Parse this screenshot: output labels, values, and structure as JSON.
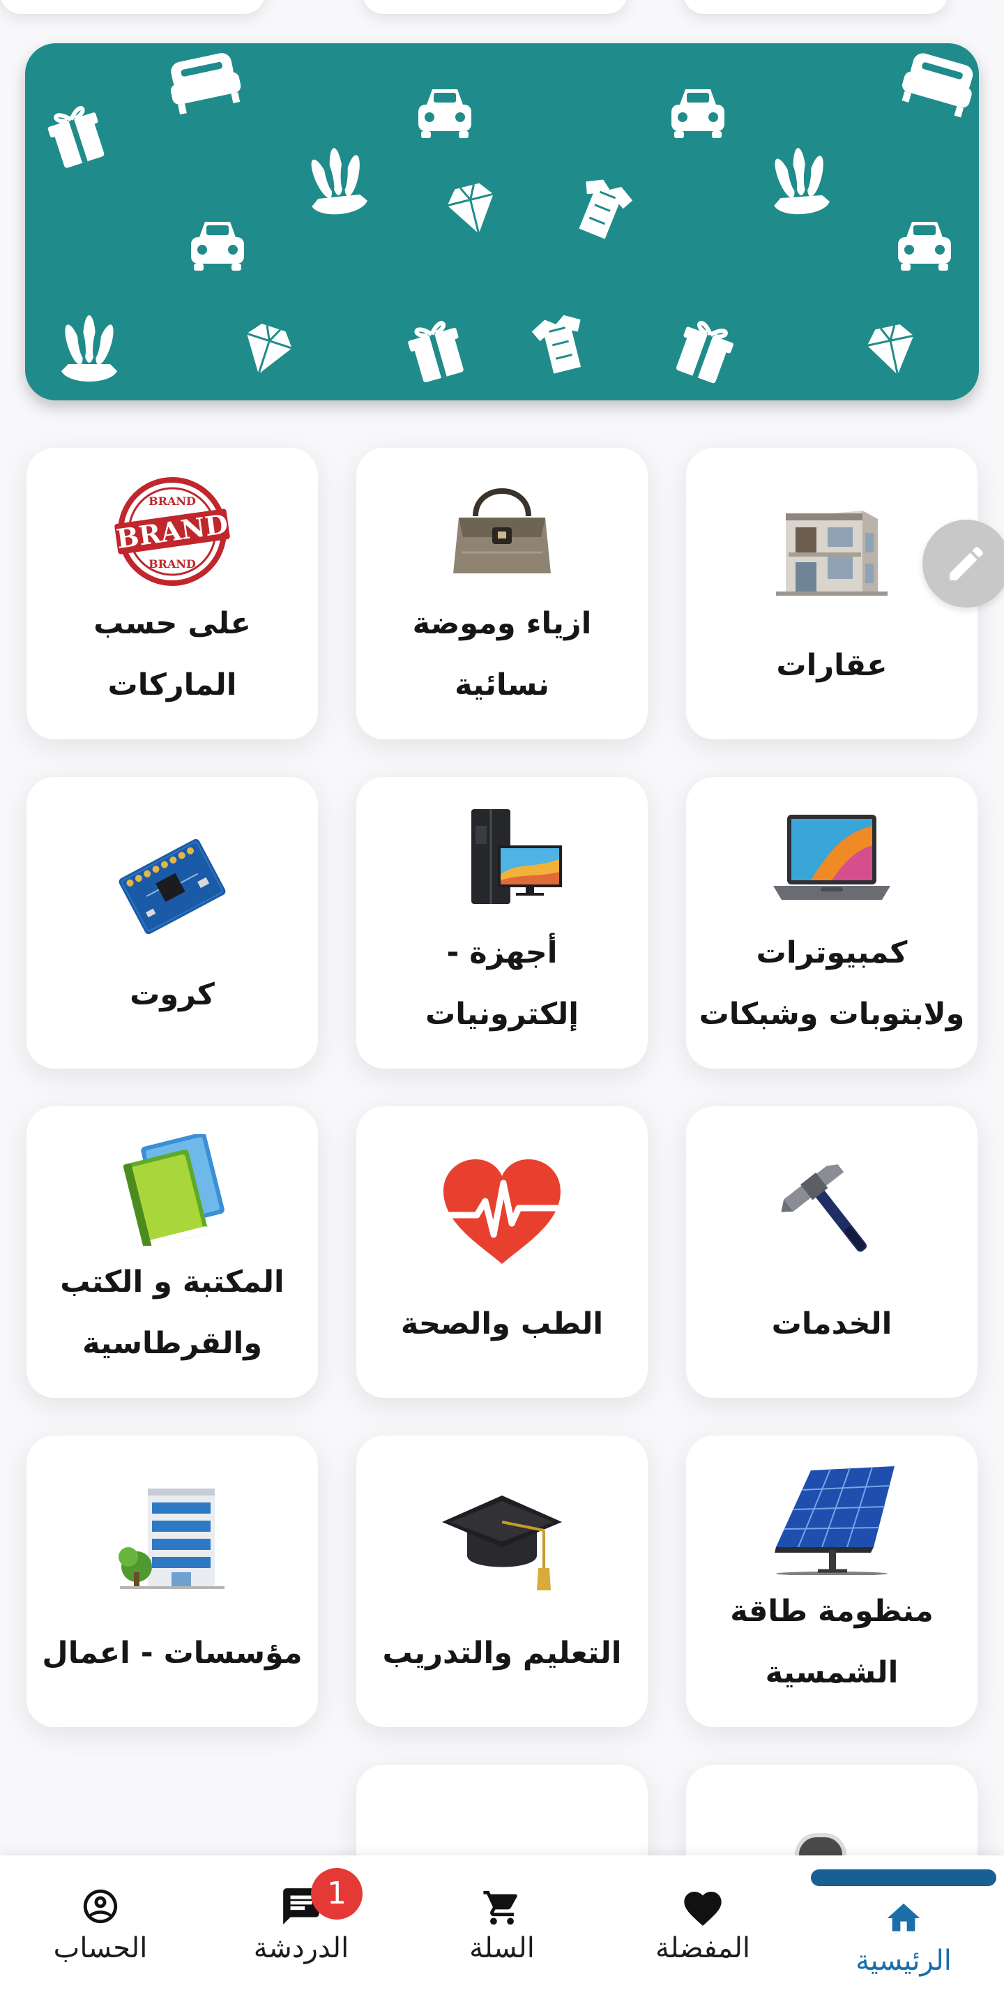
{
  "banner": {
    "background_color": "#1f8c8b",
    "pattern_icons": [
      "sofa-icon",
      "car-icon",
      "gift-icon",
      "hand-icon",
      "diamond-icon",
      "shirt-icon"
    ]
  },
  "categories": [
    {
      "label": "عقارات",
      "icon": "building-icon"
    },
    {
      "label": "ازياء وموضة نسائية",
      "icon": "handbag-icon"
    },
    {
      "label": "على حسب الماركات",
      "icon": "brand-stamp-icon",
      "stamp_text": [
        "BRAND",
        "BRAND",
        "BRAND"
      ]
    },
    {
      "label": "كمبيوترات ولابتوبات وشبكات",
      "icon": "laptop-icon"
    },
    {
      "label": "أجهزة - إلكترونيات",
      "icon": "fridge-tv-icon"
    },
    {
      "label": "كروت",
      "icon": "circuit-board-icon"
    },
    {
      "label": "الخدمات",
      "icon": "hammer-icon"
    },
    {
      "label": "الطب والصحة",
      "icon": "heart-pulse-icon"
    },
    {
      "label": "المكتبة و الكتب والقرطاسية",
      "icon": "books-icon"
    },
    {
      "label": "منظومة طاقة الشمسية",
      "icon": "solar-panel-icon"
    },
    {
      "label": "التعليم والتدريب",
      "icon": "graduation-cap-icon"
    },
    {
      "label": "مؤسسات - اعمال",
      "icon": "office-building-icon"
    }
  ],
  "bottom_nav": {
    "active_color": "#1a6fa8",
    "items": [
      {
        "label": "الرئيسية",
        "icon": "home-icon",
        "active": true
      },
      {
        "label": "المفضلة",
        "icon": "heart-icon",
        "active": false
      },
      {
        "label": "السلة",
        "icon": "cart-icon",
        "active": false
      },
      {
        "label": "الدردشة",
        "icon": "chat-icon",
        "active": false,
        "badge": "1"
      },
      {
        "label": "الحساب",
        "icon": "account-icon",
        "active": false
      }
    ]
  }
}
